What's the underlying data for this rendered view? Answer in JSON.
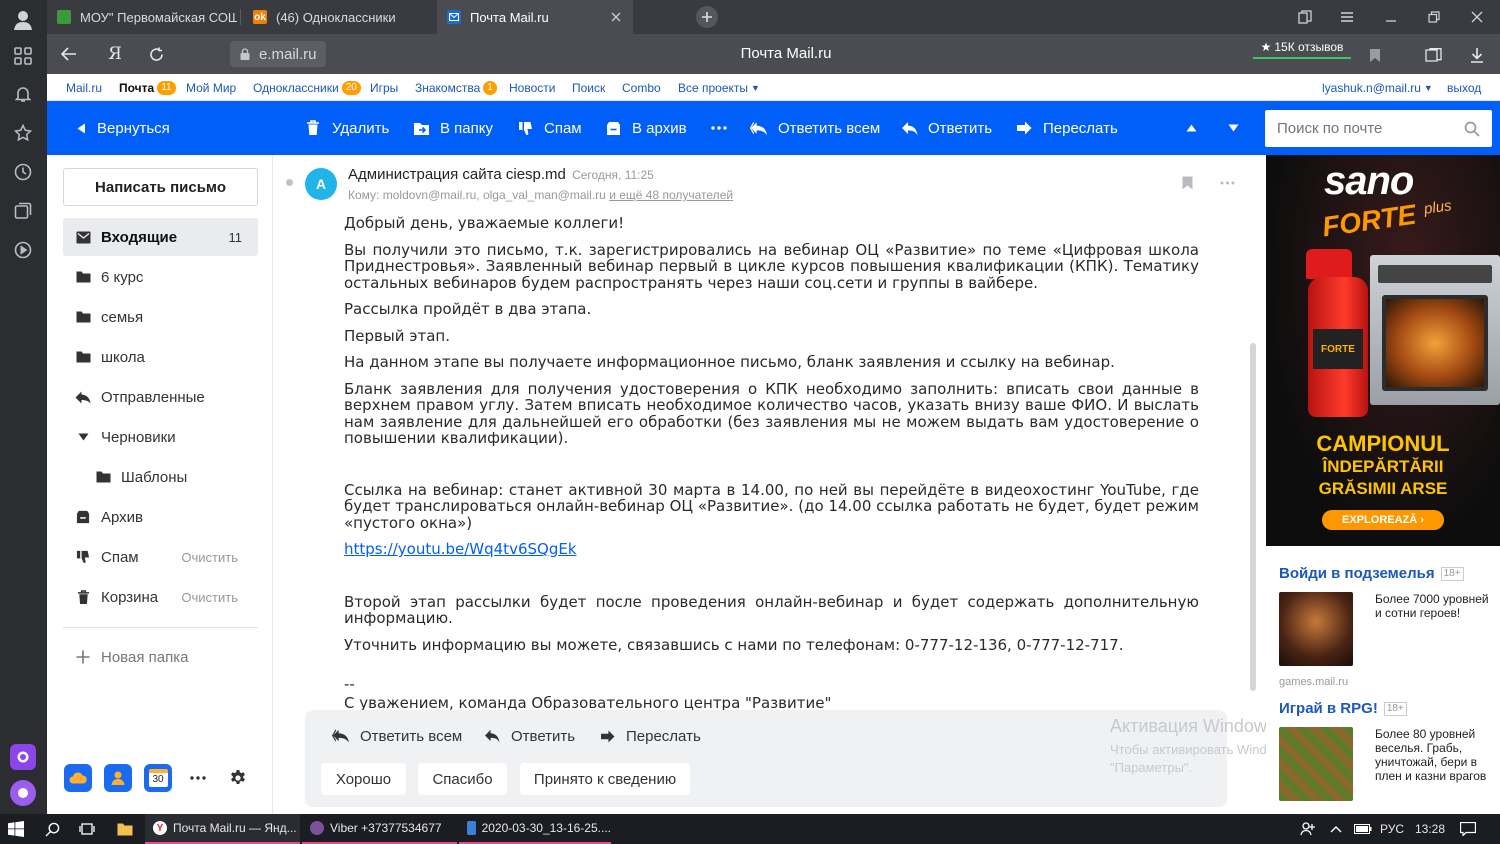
{
  "browser": {
    "tabs": [
      {
        "title": "МОУ\" Первомайская СОШ"
      },
      {
        "title": "(46) Одноклассники"
      },
      {
        "title": "Почта Mail.ru"
      }
    ],
    "url": "e.mail.ru",
    "page_title": "Почта Mail.ru",
    "reviews": "15К отзывов"
  },
  "portal_nav": {
    "items": [
      {
        "label": "Mail.ru"
      },
      {
        "label": "Почта",
        "badge": "11"
      },
      {
        "label": "Мой Мир"
      },
      {
        "label": "Одноклассники",
        "badge": "20"
      },
      {
        "label": "Игры"
      },
      {
        "label": "Знакомства",
        "badge": "1"
      },
      {
        "label": "Новости"
      },
      {
        "label": "Поиск"
      },
      {
        "label": "Combo"
      },
      {
        "label": "Все проекты"
      }
    ],
    "user": "lyashuk.n@mail.ru",
    "logout": "выход"
  },
  "toolbar": {
    "back": "Вернуться",
    "delete": "Удалить",
    "to_folder": "В папку",
    "spam": "Спам",
    "archive": "В архив",
    "reply_all": "Ответить всем",
    "reply": "Ответить",
    "forward": "Переслать",
    "search_placeholder": "Поиск по почте"
  },
  "sidebar": {
    "compose": "Написать письмо",
    "folders": [
      {
        "label": "Входящие",
        "count": "11"
      },
      {
        "label": "6 курс"
      },
      {
        "label": "семья"
      },
      {
        "label": "школа"
      },
      {
        "label": "Отправленные"
      },
      {
        "label": "Черновики"
      },
      {
        "label": "Шаблоны"
      },
      {
        "label": "Архив"
      },
      {
        "label": "Спам",
        "action": "Очистить"
      },
      {
        "label": "Корзина",
        "action": "Очистить"
      }
    ],
    "new_folder": "Новая папка",
    "calendar_day": "30"
  },
  "message": {
    "avatar_letter": "А",
    "sender": "Администрация сайта ciesp.md",
    "date": "Сегодня, 11:25",
    "to_label": "Кому:",
    "recipients": "moldovn@mail.ru, olga_val_man@mail.ru",
    "more_recipients": " и ещё 48 получателей",
    "paragraphs": [
      "Добрый день, уважаемые коллеги!",
      "Вы получили это письмо, т.к. зарегистрировались на вебинар ОЦ «Развитие» по теме «Цифровая школа Приднестровья». Заявленный вебинар первый в цикле курсов повышения квалификации (КПК). Тематику остальных вебинаров будем распространять через наши соц.сети и группы в вайбере.",
      "Рассылка пройдёт в два этапа.",
      "Первый этап.",
      "На данном этапе вы получаете информационное письмо, бланк заявления и ссылку на вебинар.",
      "Бланк заявления для получения удостоверения о КПК необходимо заполнить: вписать свои данные в верхнем правом углу. Затем вписать необходимое количество часов, указать внизу ваше ФИО. И выслать нам заявление для дальнейшей его обработки (без заявления мы не можем выдать вам удостоверение о повышении квалификации).",
      "Ссылка на вебинар: станет активной 30 марта в 14.00, по ней вы перейдёте в видеохостинг YouTube, где будет транслироваться онлайн-вебинар ОЦ «Развитие». (до 14.00 ссылка работать не будет, будет режим «пустого окна»)",
      "Второй этап рассылки будет после проведения онлайн-вебинар и будет содержать дополнительную информацию.",
      "Уточнить информацию вы можете, связавшись с нами по телефонам: 0-777-12-136, 0-777-12-717.",
      "--",
      "С уважением, команда Образовательного центра \"Развитие\""
    ],
    "link": "https://youtu.be/Wq4tv6SQgEk"
  },
  "reply_box": {
    "reply_all": "Ответить всем",
    "reply": "Ответить",
    "forward": "Переслать",
    "quick": [
      "Хорошо",
      "Спасибо",
      "Принято к сведению"
    ]
  },
  "watermark": {
    "title": "Активация Windows",
    "line1": "Чтобы активировать Windows, перейдите в раздел",
    "line2": "\"Параметры\"."
  },
  "ads": {
    "banner": {
      "brand": "sano",
      "brand2": "FORTE",
      "brand3": "plus",
      "headline1": "CAMPIONUL",
      "headline2": "ÎNDEPĂRTĂRII",
      "headline3": "GRĂSIMII ARSE",
      "cta": "EXPLOREAZĂ ›",
      "bottle_label": "FORTE"
    },
    "items": [
      {
        "title": "Войди в подземелья",
        "age": "18+",
        "text": "Более 7000 уровней и сотни героев!",
        "domain": "games.mail.ru"
      },
      {
        "title": "Играй в RPG!",
        "age": "18+",
        "text": "Более 80 уровней веселья. Грабь, уничтожай, бери в плен и казни врагов"
      }
    ]
  },
  "taskbar": {
    "apps": [
      {
        "label": "Почта Mail.ru — Янд..."
      },
      {
        "label": "Viber +37377534677"
      },
      {
        "label": "2020-03-30_13-16-25...."
      }
    ],
    "lang": "РУС",
    "time": "13:28"
  },
  "colors": {
    "accent": "#005ff9",
    "badge": "#ff9e00",
    "link": "#1b58b8"
  }
}
